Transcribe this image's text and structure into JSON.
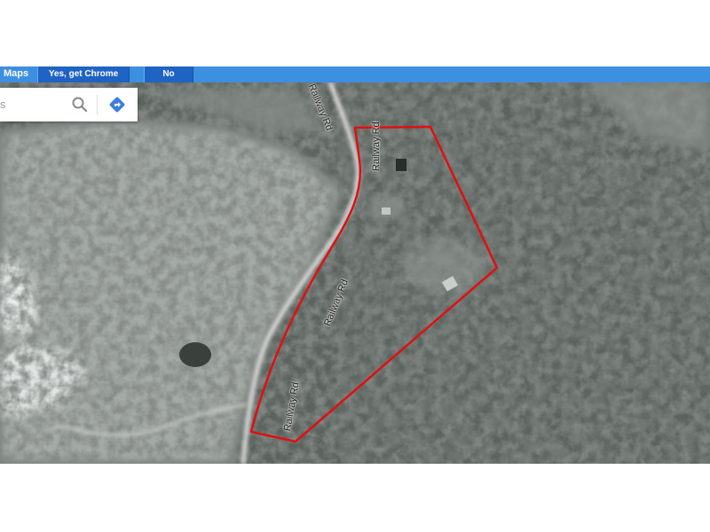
{
  "banner": {
    "title": "Maps",
    "get_chrome_label": "Yes, get Chrome now",
    "no_thanks_label": "No thanks"
  },
  "search": {
    "value": "s",
    "search_icon": "search-icon",
    "directions_icon": "directions-icon"
  },
  "map": {
    "view": "satellite",
    "road_labels": [
      "Railway Rd",
      "Railway Rd",
      "Railway Rd",
      "Railway Rd"
    ],
    "boundary_color": "#e01010",
    "road_color": "#d9d9d9"
  }
}
